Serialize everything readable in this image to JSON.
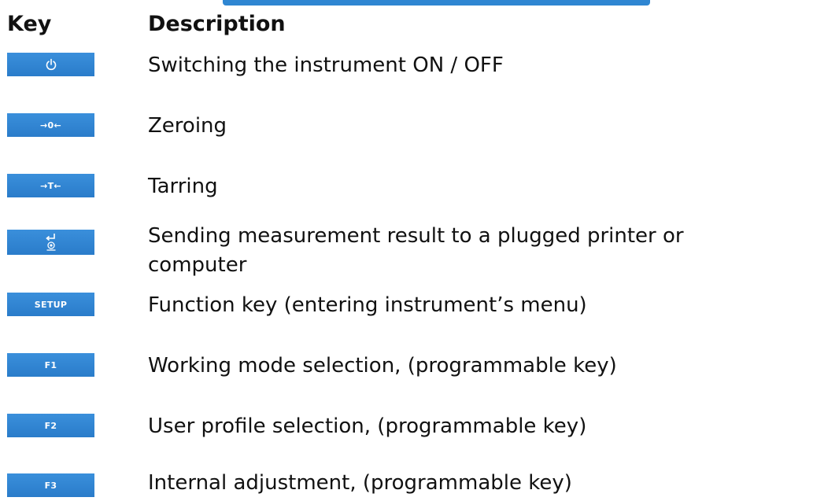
{
  "header": {
    "key": "Key",
    "description": "Description"
  },
  "rows": [
    {
      "key_icon": "power-icon",
      "key_label": "",
      "description": [
        "Switching the instrument ON / OFF"
      ]
    },
    {
      "key_icon": "zero-icon",
      "key_label": "→0←",
      "description": [
        "Zeroing"
      ]
    },
    {
      "key_icon": "tare-icon",
      "key_label": "→T←",
      "description": [
        "Tarring"
      ]
    },
    {
      "key_icon": "enter-print-icon",
      "key_label": "",
      "description": [
        "Sending measurement result to a plugged printer or",
        "computer"
      ]
    },
    {
      "key_icon": "",
      "key_label": "SETUP",
      "description": [
        "Function key (entering instrument’s menu)"
      ]
    },
    {
      "key_icon": "",
      "key_label": "F1",
      "description": [
        "Working mode selection, (programmable key)"
      ]
    },
    {
      "key_icon": "",
      "key_label": "F2",
      "description": [
        "User profile selection, (programmable key)"
      ]
    },
    {
      "key_icon": "",
      "key_label": "F3",
      "description": [
        "Internal adjustment,  (programmable key)"
      ]
    }
  ],
  "colors": {
    "key_background": "#2f86d2",
    "key_text": "#ffffff",
    "text": "#111111"
  }
}
